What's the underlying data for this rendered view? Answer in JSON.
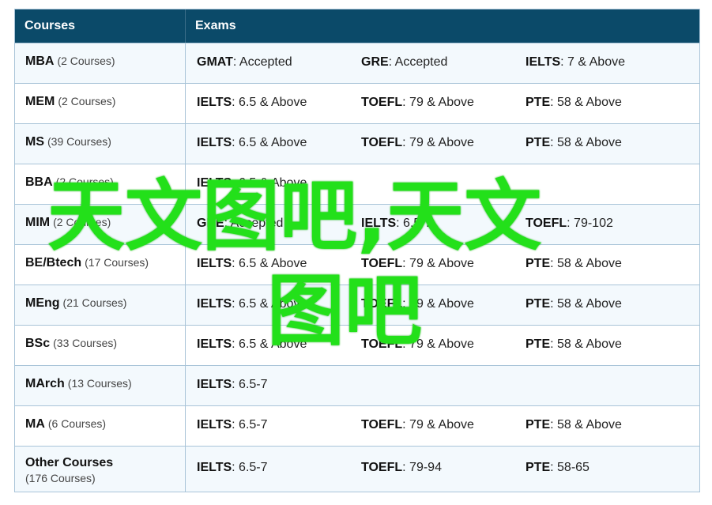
{
  "header": {
    "col_courses": "Courses",
    "col_exams": "Exams"
  },
  "rows": [
    {
      "name": "MBA",
      "count": "(2 Courses)",
      "exams": [
        {
          "name": "GMAT",
          "req": ": Accepted"
        },
        {
          "name": "GRE",
          "req": ": Accepted"
        },
        {
          "name": "IELTS",
          "req": ": 7 & Above"
        }
      ]
    },
    {
      "name": "MEM",
      "count": "(2 Courses)",
      "exams": [
        {
          "name": "IELTS",
          "req": ": 6.5 & Above"
        },
        {
          "name": "TOEFL",
          "req": ": 79 & Above"
        },
        {
          "name": "PTE",
          "req": ": 58 & Above"
        }
      ]
    },
    {
      "name": "MS",
      "count": "(39 Courses)",
      "exams": [
        {
          "name": "IELTS",
          "req": ": 6.5 & Above"
        },
        {
          "name": "TOEFL",
          "req": ": 79 & Above"
        },
        {
          "name": "PTE",
          "req": ": 58 & Above"
        }
      ]
    },
    {
      "name": "BBA",
      "count": "(2 Courses)",
      "exams": [
        {
          "name": "IELTS",
          "req": ": 6.5 & Above"
        },
        {
          "name": "",
          "req": ""
        },
        {
          "name": "",
          "req": ""
        }
      ]
    },
    {
      "name": "MIM",
      "count": "(2 Courses)",
      "exams": [
        {
          "name": "GRE",
          "req": ": Accepted"
        },
        {
          "name": "IELTS",
          "req": ": 6.5-7"
        },
        {
          "name": "TOEFL",
          "req": ": 79-102"
        }
      ]
    },
    {
      "name": "BE/Btech",
      "count": "(17 Courses)",
      "exams": [
        {
          "name": "IELTS",
          "req": ": 6.5 & Above"
        },
        {
          "name": "TOEFL",
          "req": ": 79 & Above"
        },
        {
          "name": "PTE",
          "req": ": 58 & Above"
        }
      ]
    },
    {
      "name": "MEng",
      "count": "(21 Courses)",
      "exams": [
        {
          "name": "IELTS",
          "req": ": 6.5 & Above"
        },
        {
          "name": "TOEFL",
          "req": ": 79 & Above"
        },
        {
          "name": "PTE",
          "req": ": 58 & Above"
        }
      ]
    },
    {
      "name": "BSc",
      "count": "(33 Courses)",
      "exams": [
        {
          "name": "IELTS",
          "req": ": 6.5 & Above"
        },
        {
          "name": "TOEFL",
          "req": ": 79 & Above"
        },
        {
          "name": "PTE",
          "req": ": 58 & Above"
        }
      ]
    },
    {
      "name": "MArch",
      "count": "(13 Courses)",
      "exams": [
        {
          "name": "IELTS",
          "req": ": 6.5-7"
        },
        {
          "name": "",
          "req": ""
        },
        {
          "name": "",
          "req": ""
        }
      ]
    },
    {
      "name": "MA",
      "count": "(6 Courses)",
      "exams": [
        {
          "name": "IELTS",
          "req": ": 6.5-7"
        },
        {
          "name": "TOEFL",
          "req": ": 79 & Above"
        },
        {
          "name": "PTE",
          "req": ": 58 & Above"
        }
      ]
    },
    {
      "name": "Other Courses",
      "count": "(176 Courses)",
      "exams": [
        {
          "name": "IELTS",
          "req": ": 6.5-7"
        },
        {
          "name": "TOEFL",
          "req": ": 79-94"
        },
        {
          "name": "PTE",
          "req": ": 58-65"
        }
      ]
    }
  ],
  "watermark": {
    "line1": "天文图吧,天文",
    "line2": "图吧",
    "color": "#23e01a"
  }
}
